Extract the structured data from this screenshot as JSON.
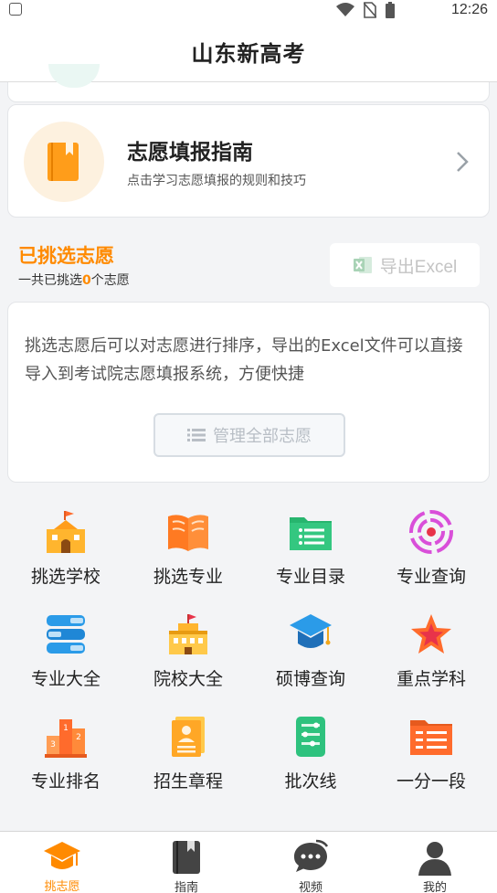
{
  "status_bar": {
    "time": "12:26"
  },
  "header": {
    "title": "山东新高考"
  },
  "guide": {
    "title": "志愿填报指南",
    "subtitle": "点击学习志愿填报的规则和技巧"
  },
  "picked": {
    "title": "已挑选志愿",
    "count_prefix": "一共已挑选",
    "count": "0",
    "count_suffix": "个志愿",
    "export_label": "导出Excel"
  },
  "info": {
    "text": "挑选志愿后可以对志愿进行排序，导出的Excel文件可以直接导入到考试院志愿填报系统，方便快捷",
    "manage_label": "管理全部志愿"
  },
  "grid": [
    {
      "label": "挑选学校",
      "icon": "school-icon"
    },
    {
      "label": "挑选专业",
      "icon": "open-book-icon"
    },
    {
      "label": "专业目录",
      "icon": "folder-list-icon"
    },
    {
      "label": "专业查询",
      "icon": "target-icon"
    },
    {
      "label": "专业大全",
      "icon": "book-stack-icon"
    },
    {
      "label": "院校大全",
      "icon": "campus-icon"
    },
    {
      "label": "硕博查询",
      "icon": "graduation-cap-icon"
    },
    {
      "label": "重点学科",
      "icon": "star-icon"
    },
    {
      "label": "专业排名",
      "icon": "podium-icon"
    },
    {
      "label": "招生章程",
      "icon": "document-person-icon"
    },
    {
      "label": "批次线",
      "icon": "list-slider-icon"
    },
    {
      "label": "一分一段",
      "icon": "folder-table-icon"
    }
  ],
  "tabs": [
    {
      "label": "挑志愿",
      "icon": "graduation-cap-icon",
      "active": true
    },
    {
      "label": "指南",
      "icon": "bookmark-book-icon",
      "active": false
    },
    {
      "label": "视频",
      "icon": "chat-bubble-icon",
      "active": false
    },
    {
      "label": "我的",
      "icon": "user-icon",
      "active": false
    }
  ],
  "colors": {
    "accent": "#ff8a00",
    "green": "#2ec27e",
    "blue": "#2b9be8"
  }
}
